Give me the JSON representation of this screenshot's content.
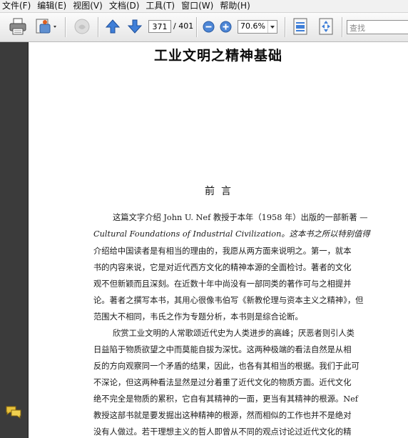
{
  "menu": [
    "文件(F)",
    "编辑(E)",
    "视图(V)",
    "文档(D)",
    "工具(T)",
    "窗口(W)",
    "帮助(H)"
  ],
  "toolbar": {
    "page_current": "371",
    "page_total": "/ 401",
    "zoom": "70.6%",
    "search_placeholder": "查找"
  },
  "icons": [
    "print-icon",
    "save-icon",
    "hand-icon",
    "previous-page-icon",
    "next-page-icon",
    "zoom-out-icon",
    "zoom-in-icon",
    "fit-page-icon",
    "fit-width-icon",
    "comments-icon"
  ],
  "document": {
    "title": "工业文明之精神基础",
    "preface_heading": "前言",
    "lines": [
      "这篇文字介绍 John U. Nef 教授于本年（1958 年）出版的一部新著 —",
      "Cultural Foundations of Industrial Civilization。这本书之所以特别值得",
      "介绍给中国读者是有相当的理由的，我愿从两方面来说明之。第一，就本",
      "书的内容来说，它是对近代西方文化的精神本源的全面检讨。著者的文化",
      "观不但新颖而且深刻。在近数十年中尚没有一部同类的著作可与之相提并",
      "论。著者之撰写本书，其用心很像韦伯写《新教伦理与资本主义之精神》，但",
      "范围大不相同，韦氏之作为专题分析，本书则是综合论断。",
      "欣赏工业文明的人常歌颂近代史为人类进步的高峰；厌恶者则引人类",
      "日益陷于物质欲望之中而莫能自拔为深忧。这两种极端的看法自然是从相",
      "反的方向观察同一个矛盾的结果，因此，也各有其相当的根据。我们于此可",
      "不深论，但这两种看法显然是过分着重了近代文化的物质方面。近代文化",
      "绝不完全是物质的累积，它自有其精神的一面，更当有其精神的根源。Nef",
      "教授这部书就是要发掘出这种精神的根源，然而相似的工作也并不是绝对",
      "没有人做过。若干理想主义的哲人即曾从不同的观点讨论过近代文化的精"
    ]
  }
}
